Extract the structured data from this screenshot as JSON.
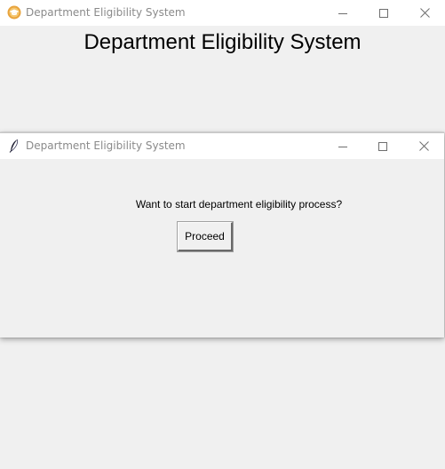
{
  "main_window": {
    "title": "Department Eligibility System",
    "heading": "Department Eligibility System",
    "icon": "graduation-cap-icon"
  },
  "dialog": {
    "title": "Department Eligibility System",
    "icon": "feather-icon",
    "prompt": "Want to start department eligibility process?",
    "proceed_label": "Proceed"
  },
  "window_controls": [
    "minimize",
    "maximize",
    "close"
  ],
  "colors": {
    "window_background": "#f0f0f0",
    "titlebar_background": "#ffffff",
    "title_text": "#8a8a8a",
    "app_icon_accent": "#e8a33c"
  }
}
